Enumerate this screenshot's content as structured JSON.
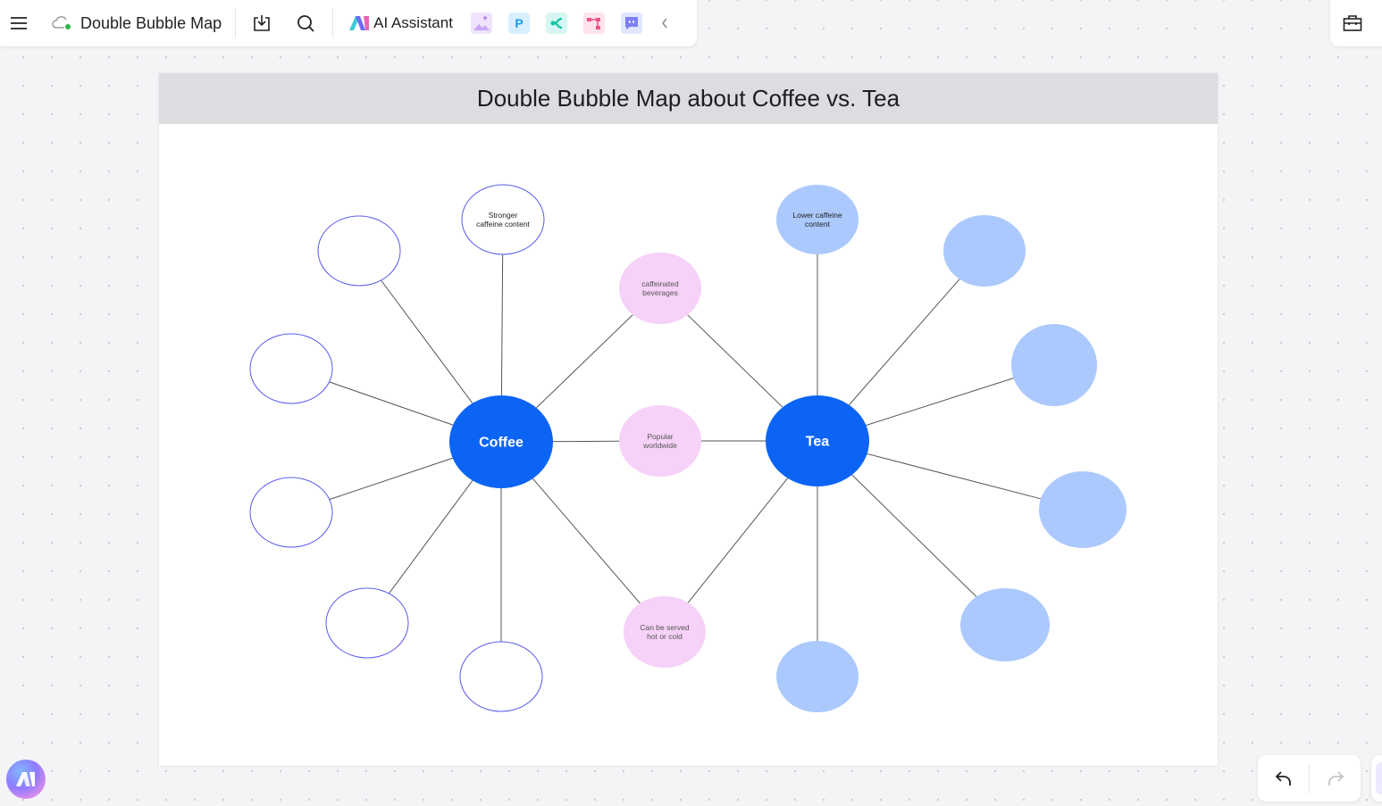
{
  "toolbar": {
    "menu_icon": "hamburger-menu-icon",
    "cloud_icon": "cloud-saved-icon",
    "doc_title": "Double Bubble Map",
    "download_icon": "download-icon",
    "search_icon": "search-icon",
    "ai_assistant_label": "AI Assistant",
    "apps": [
      {
        "name": "ai-image-icon",
        "bg": "#efe4fb",
        "fg": "#b07ff0"
      },
      {
        "name": "presentation-p-icon",
        "bg": "#d9efff",
        "fg": "#1e9bf0"
      },
      {
        "name": "mindmap-icon",
        "bg": "#d6f7f1",
        "fg": "#12c3a5"
      },
      {
        "name": "org-chart-icon",
        "bg": "#fde3ec",
        "fg": "#f0508a"
      },
      {
        "name": "chat-icon",
        "bg": "#e3e6ff",
        "fg": "#7c7ff5"
      }
    ],
    "collapse_icon": "chevron-left-icon"
  },
  "right_toolbar": {
    "toolbox_icon": "toolbox-icon"
  },
  "page": {
    "title": "Double Bubble Map about Coffee vs. Tea"
  },
  "diagram": {
    "colors": {
      "main": "#0c64f5",
      "shared": "#f6d1f8",
      "tea_attr": "#abc9fd",
      "coffee_attr_stroke": "#5b5bea",
      "line": "#555555"
    },
    "topics": [
      {
        "id": "coffee",
        "label": "Coffee"
      },
      {
        "id": "tea",
        "label": "Tea"
      }
    ],
    "shared": [
      {
        "label_lines": [
          "caffeinated",
          "beverages"
        ]
      },
      {
        "label_lines": [
          "Popular",
          "worldwide"
        ]
      },
      {
        "label_lines": [
          "Can be served",
          "hot or cold"
        ]
      }
    ],
    "coffee_attributes": [
      {
        "label_lines": [
          "Stronger",
          "caffeine content"
        ]
      },
      {
        "label_lines": []
      },
      {
        "label_lines": []
      },
      {
        "label_lines": []
      },
      {
        "label_lines": []
      },
      {
        "label_lines": []
      }
    ],
    "tea_attributes": [
      {
        "label_lines": [
          "Lower caffeine",
          "content"
        ]
      },
      {
        "label_lines": []
      },
      {
        "label_lines": []
      },
      {
        "label_lines": []
      },
      {
        "label_lines": []
      },
      {
        "label_lines": []
      }
    ]
  },
  "bottom": {
    "ai_orb_icon": "ai-assistant-orb-icon",
    "undo_icon": "undo-icon",
    "redo_icon": "redo-icon"
  }
}
